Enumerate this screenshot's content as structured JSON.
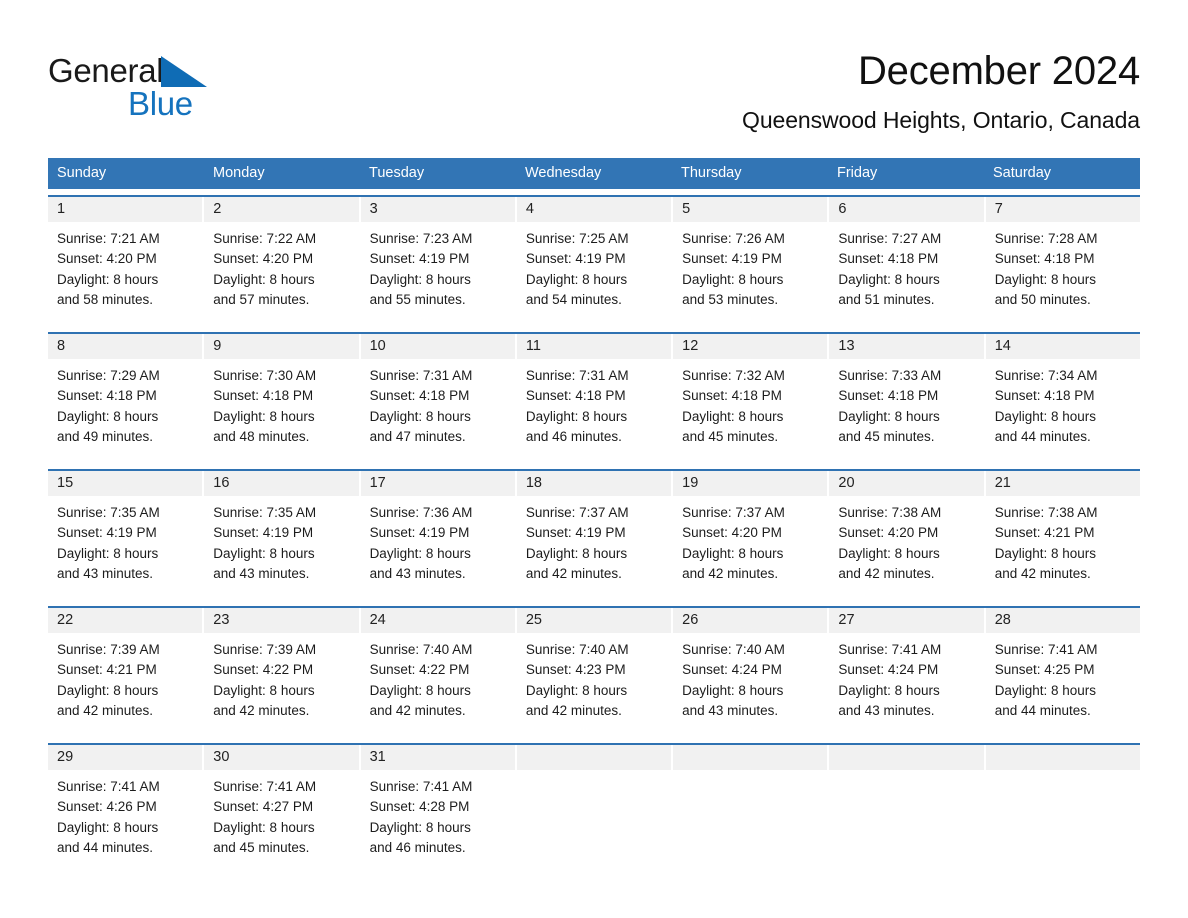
{
  "logo": {
    "word_black": "General",
    "word_blue": "Blue",
    "triangle_color": "#0f6cb5"
  },
  "header": {
    "title": "December 2024",
    "subtitle": "Queenswood Heights, Ontario, Canada"
  },
  "colors": {
    "header_blue": "#3275b5",
    "row_rule_blue": "#2f72b2",
    "daynum_band": "#f1f1f1",
    "text": "#1c1c1c"
  },
  "calendar": {
    "day_headers": [
      "Sunday",
      "Monday",
      "Tuesday",
      "Wednesday",
      "Thursday",
      "Friday",
      "Saturday"
    ],
    "weeks": [
      [
        {
          "day": "1",
          "l1": "Sunrise: 7:21 AM",
          "l2": "Sunset: 4:20 PM",
          "l3": "Daylight: 8 hours",
          "l4": "and 58 minutes."
        },
        {
          "day": "2",
          "l1": "Sunrise: 7:22 AM",
          "l2": "Sunset: 4:20 PM",
          "l3": "Daylight: 8 hours",
          "l4": "and 57 minutes."
        },
        {
          "day": "3",
          "l1": "Sunrise: 7:23 AM",
          "l2": "Sunset: 4:19 PM",
          "l3": "Daylight: 8 hours",
          "l4": "and 55 minutes."
        },
        {
          "day": "4",
          "l1": "Sunrise: 7:25 AM",
          "l2": "Sunset: 4:19 PM",
          "l3": "Daylight: 8 hours",
          "l4": "and 54 minutes."
        },
        {
          "day": "5",
          "l1": "Sunrise: 7:26 AM",
          "l2": "Sunset: 4:19 PM",
          "l3": "Daylight: 8 hours",
          "l4": "and 53 minutes."
        },
        {
          "day": "6",
          "l1": "Sunrise: 7:27 AM",
          "l2": "Sunset: 4:18 PM",
          "l3": "Daylight: 8 hours",
          "l4": "and 51 minutes."
        },
        {
          "day": "7",
          "l1": "Sunrise: 7:28 AM",
          "l2": "Sunset: 4:18 PM",
          "l3": "Daylight: 8 hours",
          "l4": "and 50 minutes."
        }
      ],
      [
        {
          "day": "8",
          "l1": "Sunrise: 7:29 AM",
          "l2": "Sunset: 4:18 PM",
          "l3": "Daylight: 8 hours",
          "l4": "and 49 minutes."
        },
        {
          "day": "9",
          "l1": "Sunrise: 7:30 AM",
          "l2": "Sunset: 4:18 PM",
          "l3": "Daylight: 8 hours",
          "l4": "and 48 minutes."
        },
        {
          "day": "10",
          "l1": "Sunrise: 7:31 AM",
          "l2": "Sunset: 4:18 PM",
          "l3": "Daylight: 8 hours",
          "l4": "and 47 minutes."
        },
        {
          "day": "11",
          "l1": "Sunrise: 7:31 AM",
          "l2": "Sunset: 4:18 PM",
          "l3": "Daylight: 8 hours",
          "l4": "and 46 minutes."
        },
        {
          "day": "12",
          "l1": "Sunrise: 7:32 AM",
          "l2": "Sunset: 4:18 PM",
          "l3": "Daylight: 8 hours",
          "l4": "and 45 minutes."
        },
        {
          "day": "13",
          "l1": "Sunrise: 7:33 AM",
          "l2": "Sunset: 4:18 PM",
          "l3": "Daylight: 8 hours",
          "l4": "and 45 minutes."
        },
        {
          "day": "14",
          "l1": "Sunrise: 7:34 AM",
          "l2": "Sunset: 4:18 PM",
          "l3": "Daylight: 8 hours",
          "l4": "and 44 minutes."
        }
      ],
      [
        {
          "day": "15",
          "l1": "Sunrise: 7:35 AM",
          "l2": "Sunset: 4:19 PM",
          "l3": "Daylight: 8 hours",
          "l4": "and 43 minutes."
        },
        {
          "day": "16",
          "l1": "Sunrise: 7:35 AM",
          "l2": "Sunset: 4:19 PM",
          "l3": "Daylight: 8 hours",
          "l4": "and 43 minutes."
        },
        {
          "day": "17",
          "l1": "Sunrise: 7:36 AM",
          "l2": "Sunset: 4:19 PM",
          "l3": "Daylight: 8 hours",
          "l4": "and 43 minutes."
        },
        {
          "day": "18",
          "l1": "Sunrise: 7:37 AM",
          "l2": "Sunset: 4:19 PM",
          "l3": "Daylight: 8 hours",
          "l4": "and 42 minutes."
        },
        {
          "day": "19",
          "l1": "Sunrise: 7:37 AM",
          "l2": "Sunset: 4:20 PM",
          "l3": "Daylight: 8 hours",
          "l4": "and 42 minutes."
        },
        {
          "day": "20",
          "l1": "Sunrise: 7:38 AM",
          "l2": "Sunset: 4:20 PM",
          "l3": "Daylight: 8 hours",
          "l4": "and 42 minutes."
        },
        {
          "day": "21",
          "l1": "Sunrise: 7:38 AM",
          "l2": "Sunset: 4:21 PM",
          "l3": "Daylight: 8 hours",
          "l4": "and 42 minutes."
        }
      ],
      [
        {
          "day": "22",
          "l1": "Sunrise: 7:39 AM",
          "l2": "Sunset: 4:21 PM",
          "l3": "Daylight: 8 hours",
          "l4": "and 42 minutes."
        },
        {
          "day": "23",
          "l1": "Sunrise: 7:39 AM",
          "l2": "Sunset: 4:22 PM",
          "l3": "Daylight: 8 hours",
          "l4": "and 42 minutes."
        },
        {
          "day": "24",
          "l1": "Sunrise: 7:40 AM",
          "l2": "Sunset: 4:22 PM",
          "l3": "Daylight: 8 hours",
          "l4": "and 42 minutes."
        },
        {
          "day": "25",
          "l1": "Sunrise: 7:40 AM",
          "l2": "Sunset: 4:23 PM",
          "l3": "Daylight: 8 hours",
          "l4": "and 42 minutes."
        },
        {
          "day": "26",
          "l1": "Sunrise: 7:40 AM",
          "l2": "Sunset: 4:24 PM",
          "l3": "Daylight: 8 hours",
          "l4": "and 43 minutes."
        },
        {
          "day": "27",
          "l1": "Sunrise: 7:41 AM",
          "l2": "Sunset: 4:24 PM",
          "l3": "Daylight: 8 hours",
          "l4": "and 43 minutes."
        },
        {
          "day": "28",
          "l1": "Sunrise: 7:41 AM",
          "l2": "Sunset: 4:25 PM",
          "l3": "Daylight: 8 hours",
          "l4": "and 44 minutes."
        }
      ],
      [
        {
          "day": "29",
          "l1": "Sunrise: 7:41 AM",
          "l2": "Sunset: 4:26 PM",
          "l3": "Daylight: 8 hours",
          "l4": "and 44 minutes."
        },
        {
          "day": "30",
          "l1": "Sunrise: 7:41 AM",
          "l2": "Sunset: 4:27 PM",
          "l3": "Daylight: 8 hours",
          "l4": "and 45 minutes."
        },
        {
          "day": "31",
          "l1": "Sunrise: 7:41 AM",
          "l2": "Sunset: 4:28 PM",
          "l3": "Daylight: 8 hours",
          "l4": "and 46 minutes."
        },
        {
          "day": "",
          "l1": "",
          "l2": "",
          "l3": "",
          "l4": ""
        },
        {
          "day": "",
          "l1": "",
          "l2": "",
          "l3": "",
          "l4": ""
        },
        {
          "day": "",
          "l1": "",
          "l2": "",
          "l3": "",
          "l4": ""
        },
        {
          "day": "",
          "l1": "",
          "l2": "",
          "l3": "",
          "l4": ""
        }
      ]
    ]
  }
}
